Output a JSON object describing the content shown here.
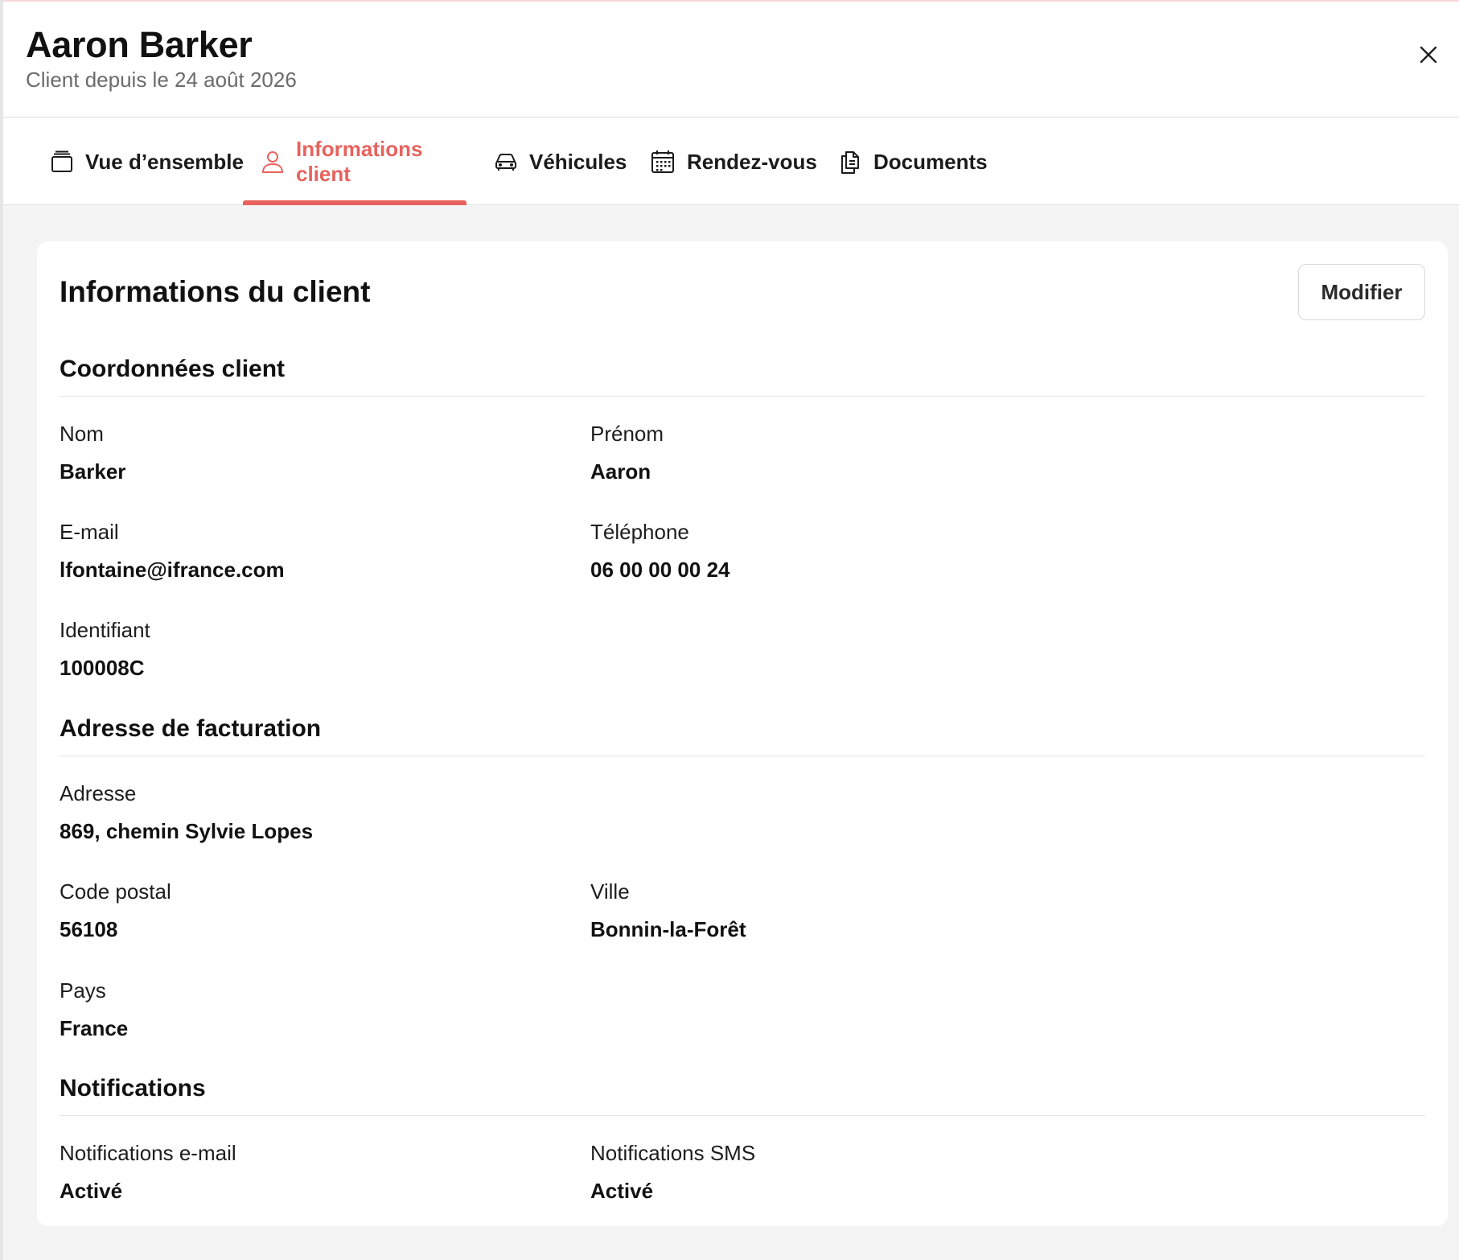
{
  "header": {
    "client_name": "Aaron Barker",
    "client_since": "Client depuis le 24 août 2026",
    "close_icon": "close-icon"
  },
  "tabs": [
    {
      "label": "Vue d’ensemble",
      "icon": "overview-icon",
      "active": false
    },
    {
      "label": "Informations client",
      "icon": "user-icon",
      "active": true
    },
    {
      "label": "Véhicules",
      "icon": "car-icon",
      "active": false
    },
    {
      "label": "Rendez-vous",
      "icon": "calendar-icon",
      "active": false
    },
    {
      "label": "Documents",
      "icon": "documents-icon",
      "active": false
    }
  ],
  "card": {
    "title": "Informations du client",
    "modify_label": "Modifier"
  },
  "sections": {
    "coordonnees": {
      "title": "Coordonnées client",
      "nom": {
        "label": "Nom",
        "value": "Barker"
      },
      "prenom": {
        "label": "Prénom",
        "value": "Aaron"
      },
      "email": {
        "label": "E-mail",
        "value": "lfontaine@ifrance.com"
      },
      "telephone": {
        "label": "Téléphone",
        "value": "06 00 00 00 24"
      },
      "identifiant": {
        "label": "Identifiant",
        "value": "100008C"
      }
    },
    "facturation": {
      "title": "Adresse de facturation",
      "adresse": {
        "label": "Adresse",
        "value": "869, chemin Sylvie Lopes"
      },
      "code_postal": {
        "label": "Code postal",
        "value": "56108"
      },
      "ville": {
        "label": "Ville",
        "value": "Bonnin-la-Forêt"
      },
      "pays": {
        "label": "Pays",
        "value": "France"
      }
    },
    "notifications": {
      "title": "Notifications",
      "email": {
        "label": "Notifications e-mail",
        "value": "Activé"
      },
      "sms": {
        "label": "Notifications SMS",
        "value": "Activé"
      }
    }
  },
  "colors": {
    "accent": "#e8625d",
    "background": "#f4f4f4",
    "card": "#ffffff"
  }
}
